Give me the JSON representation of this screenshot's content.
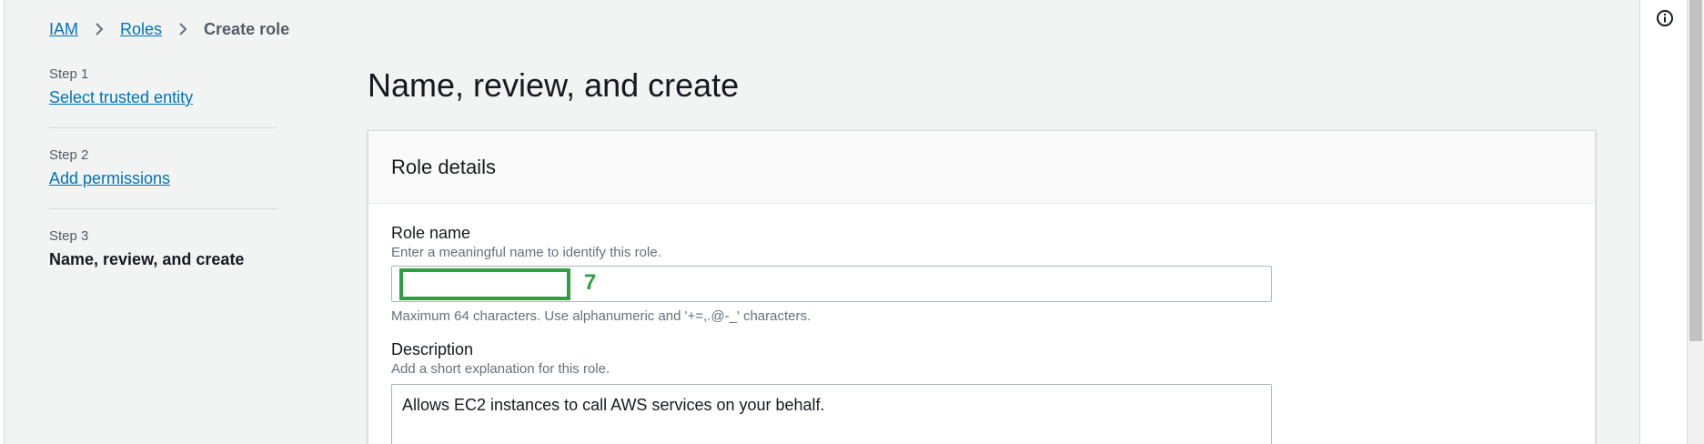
{
  "breadcrumb": {
    "items": [
      "IAM",
      "Roles"
    ],
    "current": "Create role"
  },
  "steps": [
    {
      "number": "Step 1",
      "label": "Select trusted entity"
    },
    {
      "number": "Step 2",
      "label": "Add permissions"
    },
    {
      "number": "Step 3",
      "label": "Name, review, and create"
    }
  ],
  "page": {
    "title": "Name, review, and create"
  },
  "role_details": {
    "header": "Role details",
    "role_name": {
      "label": "Role name",
      "description": "Enter a meaningful name to identify this role.",
      "value": "",
      "constraint": "Maximum 64 characters. Use alphanumeric and '+=,.@-_' characters.",
      "annotation_label": "7"
    },
    "description": {
      "label": "Description",
      "description": "Add a short explanation for this role.",
      "value": "Allows EC2 instances to call AWS services on your behalf."
    }
  },
  "colors": {
    "link": "#0073bb",
    "highlight": "#2ea043",
    "background": "#f2f3f3"
  },
  "icons": {
    "breadcrumb_separator": "chevron-right-icon",
    "info": "info-icon"
  }
}
